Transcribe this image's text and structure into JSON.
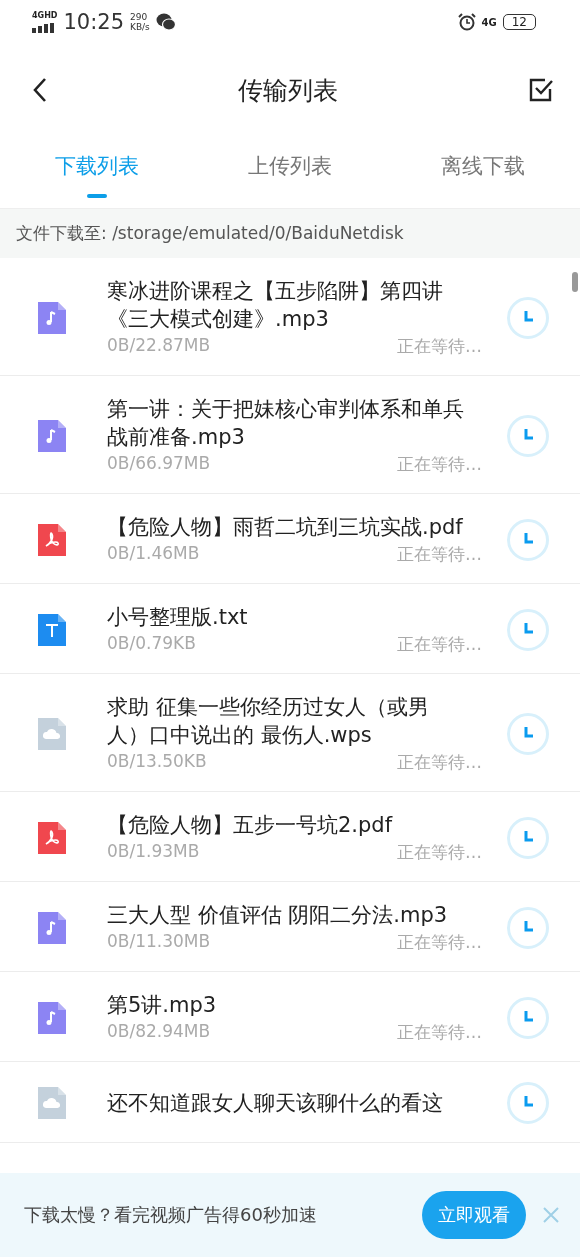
{
  "status_bar": {
    "network": "4GHD",
    "time": "10:25",
    "speed_value": "290",
    "speed_unit": "KB/s",
    "network_right": "4G",
    "battery": "12"
  },
  "header": {
    "title": "传输列表"
  },
  "tabs": [
    {
      "label": "下载列表",
      "selected": true
    },
    {
      "label": "上传列表",
      "selected": false
    },
    {
      "label": "离线下载",
      "selected": false
    }
  ],
  "path_bar": "文件下载至: /storage/emulated/0/BaiduNetdisk",
  "items": [
    {
      "kind": "audio",
      "name": "寒冰进阶课程之【五步陷阱】第四讲《三大模式创建》.mp3",
      "size": "0B/22.87MB",
      "status": "正在等待…"
    },
    {
      "kind": "audio",
      "name": "第一讲：关于把妹核心审判体系和单兵战前准备.mp3",
      "size": "0B/66.97MB",
      "status": "正在等待…"
    },
    {
      "kind": "pdf",
      "name": "【危险人物】雨哲二坑到三坑实战.pdf",
      "size": "0B/1.46MB",
      "status": "正在等待…"
    },
    {
      "kind": "text",
      "name": "小号整理版.txt",
      "size": "0B/0.79KB",
      "status": "正在等待…"
    },
    {
      "kind": "cloud",
      "name": "求助 征集一些你经历过女人（或男人）口中说出的 最伤人.wps",
      "size": "0B/13.50KB",
      "status": "正在等待…"
    },
    {
      "kind": "pdf",
      "name": "【危险人物】五步一号坑2.pdf",
      "size": "0B/1.93MB",
      "status": "正在等待…"
    },
    {
      "kind": "audio",
      "name": "三大人型 价值评估 阴阳二分法.mp3",
      "size": "0B/11.30MB",
      "status": "正在等待…"
    },
    {
      "kind": "audio",
      "name": "第5讲.mp3",
      "size": "0B/82.94MB",
      "status": "正在等待…"
    },
    {
      "kind": "cloud",
      "name": "还不知道跟女人聊天该聊什么的看这"
    }
  ],
  "banner": {
    "text": "下载太慢？看完视频广告得60秒加速",
    "button": "立即观看"
  }
}
